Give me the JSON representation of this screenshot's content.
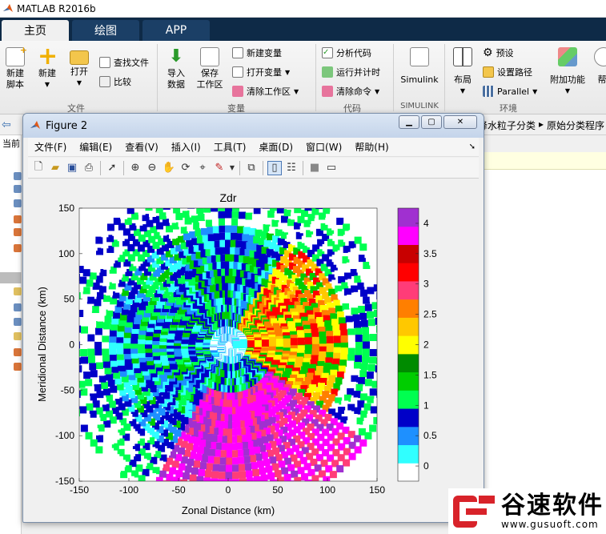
{
  "app": {
    "title": "MATLAB R2016b"
  },
  "tabs": [
    {
      "label": "主页"
    },
    {
      "label": "绘图"
    },
    {
      "label": "APP"
    }
  ],
  "ribbon": {
    "file": {
      "new_script": "新建\n脚本",
      "new": "新建",
      "open": "打开",
      "find_files": "查找文件",
      "compare": "比较",
      "group": "文件"
    },
    "variable": {
      "import": "导入\n数据",
      "save_ws": "保存\n工作区",
      "new_var": "新建变量",
      "open_var": "打开变量",
      "clear_ws": "清除工作区",
      "group": "变量"
    },
    "code": {
      "analyze": "分析代码",
      "run_time": "运行并计时",
      "clear_cmd": "清除命令",
      "group": "代码"
    },
    "simulink": {
      "label": "Simulink",
      "group": "SIMULINK"
    },
    "env": {
      "layout": "布局",
      "prefs": "预设",
      "set_path": "设置路径",
      "parallel": "Parallel",
      "addons": "附加功能",
      "group": "环境",
      "help_partial": "帮"
    }
  },
  "path": {
    "crumb1": "降水粒子分类",
    "crumb2": "原始分类程序",
    "current_label": "当前"
  },
  "figure": {
    "title": "Figure 2",
    "menu": [
      "文件(F)",
      "编辑(E)",
      "查看(V)",
      "插入(I)",
      "工具(T)",
      "桌面(D)",
      "窗口(W)",
      "帮助(H)"
    ]
  },
  "chart_data": {
    "type": "heatmap",
    "title": "Zdr",
    "xlabel": "Zonal Distance (km)",
    "ylabel": "Meridional Distance (km)",
    "xlim": [
      -150,
      150
    ],
    "ylim": [
      -150,
      150
    ],
    "xticks": [
      "-150",
      "-100",
      "-50",
      "0",
      "50",
      "100",
      "150"
    ],
    "yticks": [
      "150",
      "100",
      "50",
      "0",
      "-50",
      "-100",
      "-150"
    ],
    "colorbar": {
      "range": [
        -0.25,
        4.25
      ],
      "ticks": [
        "4",
        "3.5",
        "3",
        "2.5",
        "2",
        "1.5",
        "1",
        "0.5",
        "0"
      ],
      "colors": [
        "#ffffff",
        "#30ffff",
        "#1e90ff",
        "#0000c8",
        "#00ff50",
        "#00cd00",
        "#008b00",
        "#ffff00",
        "#ffc800",
        "#ff7f00",
        "#ff3c78",
        "#ff0000",
        "#c80000",
        "#ff00ff",
        "#a030d0"
      ]
    }
  },
  "watermark": {
    "name": "谷速软件",
    "url": "www.gusuoft.com"
  }
}
